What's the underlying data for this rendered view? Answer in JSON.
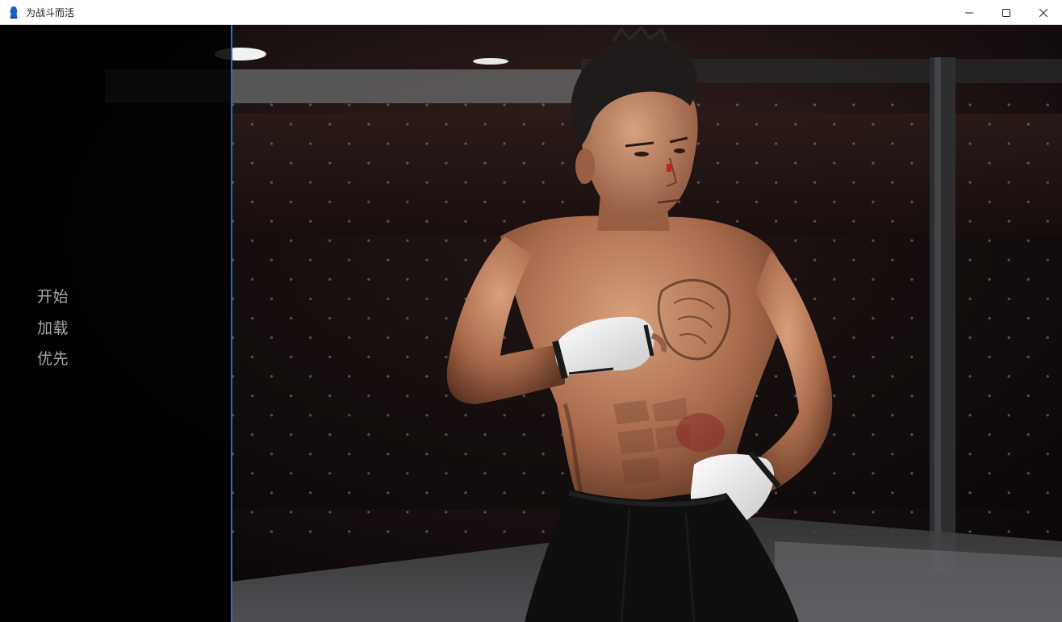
{
  "window": {
    "title": "为战斗而活",
    "controls": {
      "minimize_icon": "minimize-icon",
      "maximize_icon": "maximize-icon",
      "close_icon": "close-icon"
    }
  },
  "main_menu": {
    "items": [
      {
        "label": "开始"
      },
      {
        "label": "加载"
      },
      {
        "label": "优先"
      }
    ]
  },
  "colors": {
    "accent_border": "#1e6fd9",
    "menu_text": "#a8a8a8",
    "panel_bg": "#000000"
  },
  "scene": {
    "description_icon": "fighter-artwork"
  }
}
